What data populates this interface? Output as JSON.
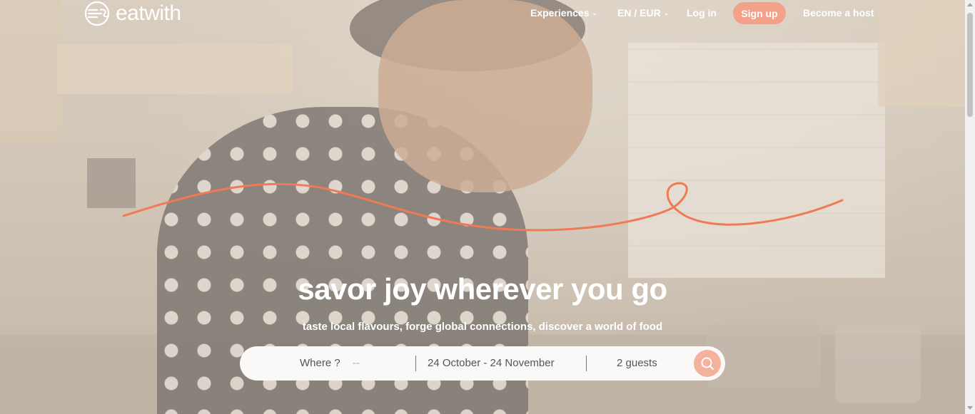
{
  "brand": {
    "name": "eatwith",
    "logo_icon": "plate-cutlery-icon"
  },
  "nav": {
    "experiences": "Experiences",
    "language_currency": "EN / EUR",
    "login": "Log in",
    "signup": "Sign up",
    "become_host": "Become a host"
  },
  "hero": {
    "title": "savor joy wherever you go",
    "subtitle": "taste local flavours, forge global connections, discover a world of food"
  },
  "search": {
    "where_label": "Where ?",
    "where_placeholder": "--",
    "dates": "24 October - 24 November",
    "guests": "2 guests",
    "button_icon": "search-icon"
  },
  "colors": {
    "accent": "#f4a18a",
    "squiggle": "#f07a55",
    "search_button": "#f4b29d"
  }
}
